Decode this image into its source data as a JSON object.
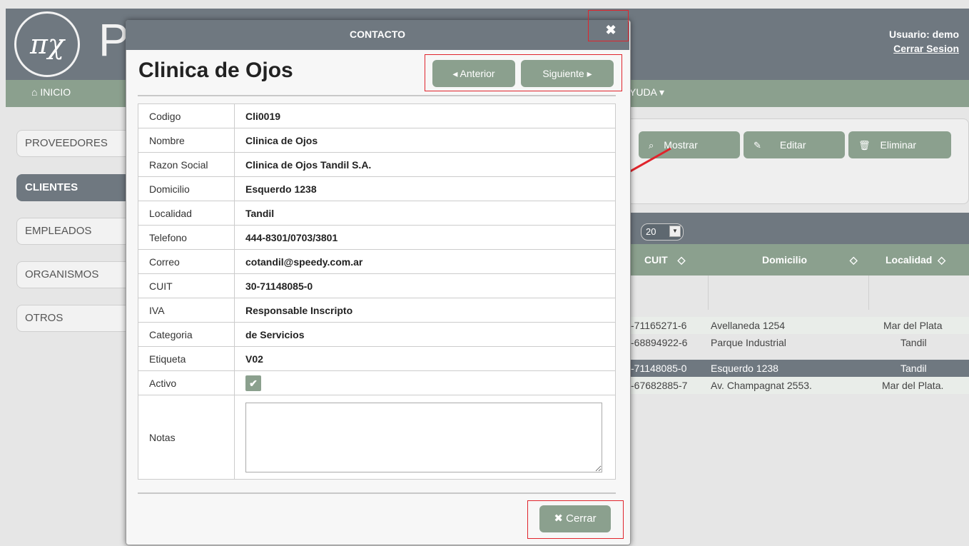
{
  "header": {
    "logo_symbol": "πχ",
    "logo_letter": "P",
    "user_label": "Usuario: demo",
    "logout_link": "Cerrar Sesion"
  },
  "navbar": {
    "home_icon": "home-icon",
    "home": "INICIO",
    "help": "YUDA ▾"
  },
  "sidebar": {
    "items": [
      {
        "label": "PROVEEDORES"
      },
      {
        "label": "CLIENTES"
      },
      {
        "label": "EMPLEADOS"
      },
      {
        "label": "ORGANISMOS"
      },
      {
        "label": "OTROS"
      }
    ]
  },
  "actions": {
    "show": {
      "label": "Mostrar",
      "icon": "search-icon"
    },
    "edit": {
      "label": "Editar",
      "icon": "pencil-icon"
    },
    "delete": {
      "label": "Eliminar",
      "icon": "trash-icon"
    }
  },
  "grid": {
    "page_size": "20",
    "columns": [
      "CUIT",
      "Domicilio",
      "Localidad"
    ],
    "rows": [
      {
        "cuit": "-71165271-6",
        "domicilio": "Avellaneda 1254",
        "localidad": "Mar del Plata"
      },
      {
        "cuit": "-68894922-6",
        "domicilio": "Parque Industrial",
        "localidad": "Tandil"
      },
      {
        "cuit": "-71148085-0",
        "domicilio": "Esquerdo 1238",
        "localidad": "Tandil"
      },
      {
        "cuit": "-67682885-7",
        "domicilio": "Av. Champagnat 2553.",
        "localidad": "Mar del Plata."
      }
    ]
  },
  "modal": {
    "title": "CONTACTO",
    "close_icon": "✖",
    "heading": "Clinica de Ojos",
    "prev_label": "◂ Anterior",
    "next_label": "Siguiente ▸",
    "fields": [
      {
        "label": "Codigo",
        "value": "Cli0019"
      },
      {
        "label": "Nombre",
        "value": "Clinica de Ojos"
      },
      {
        "label": "Razon Social",
        "value": "Clinica de Ojos Tandil S.A."
      },
      {
        "label": "Domicilio",
        "value": "Esquerdo 1238"
      },
      {
        "label": "Localidad",
        "value": "Tandil"
      },
      {
        "label": "Telefono",
        "value": "444-8301/0703/3801"
      },
      {
        "label": "Correo",
        "value": "cotandil@speedy.com.ar"
      },
      {
        "label": "CUIT",
        "value": "30-71148085-0"
      },
      {
        "label": "IVA",
        "value": "Responsable Inscripto"
      },
      {
        "label": "Categoria",
        "value": "de Servicios"
      },
      {
        "label": "Etiqueta",
        "value": "V02"
      }
    ],
    "active_label": "Activo",
    "active_checked": "✔",
    "notes_label": "Notas",
    "notes_value": "",
    "close_button": "✖ Cerrar"
  },
  "colors": {
    "accent": "#8ba08e",
    "header": "#6f7880",
    "annotation": "#e0242c"
  }
}
